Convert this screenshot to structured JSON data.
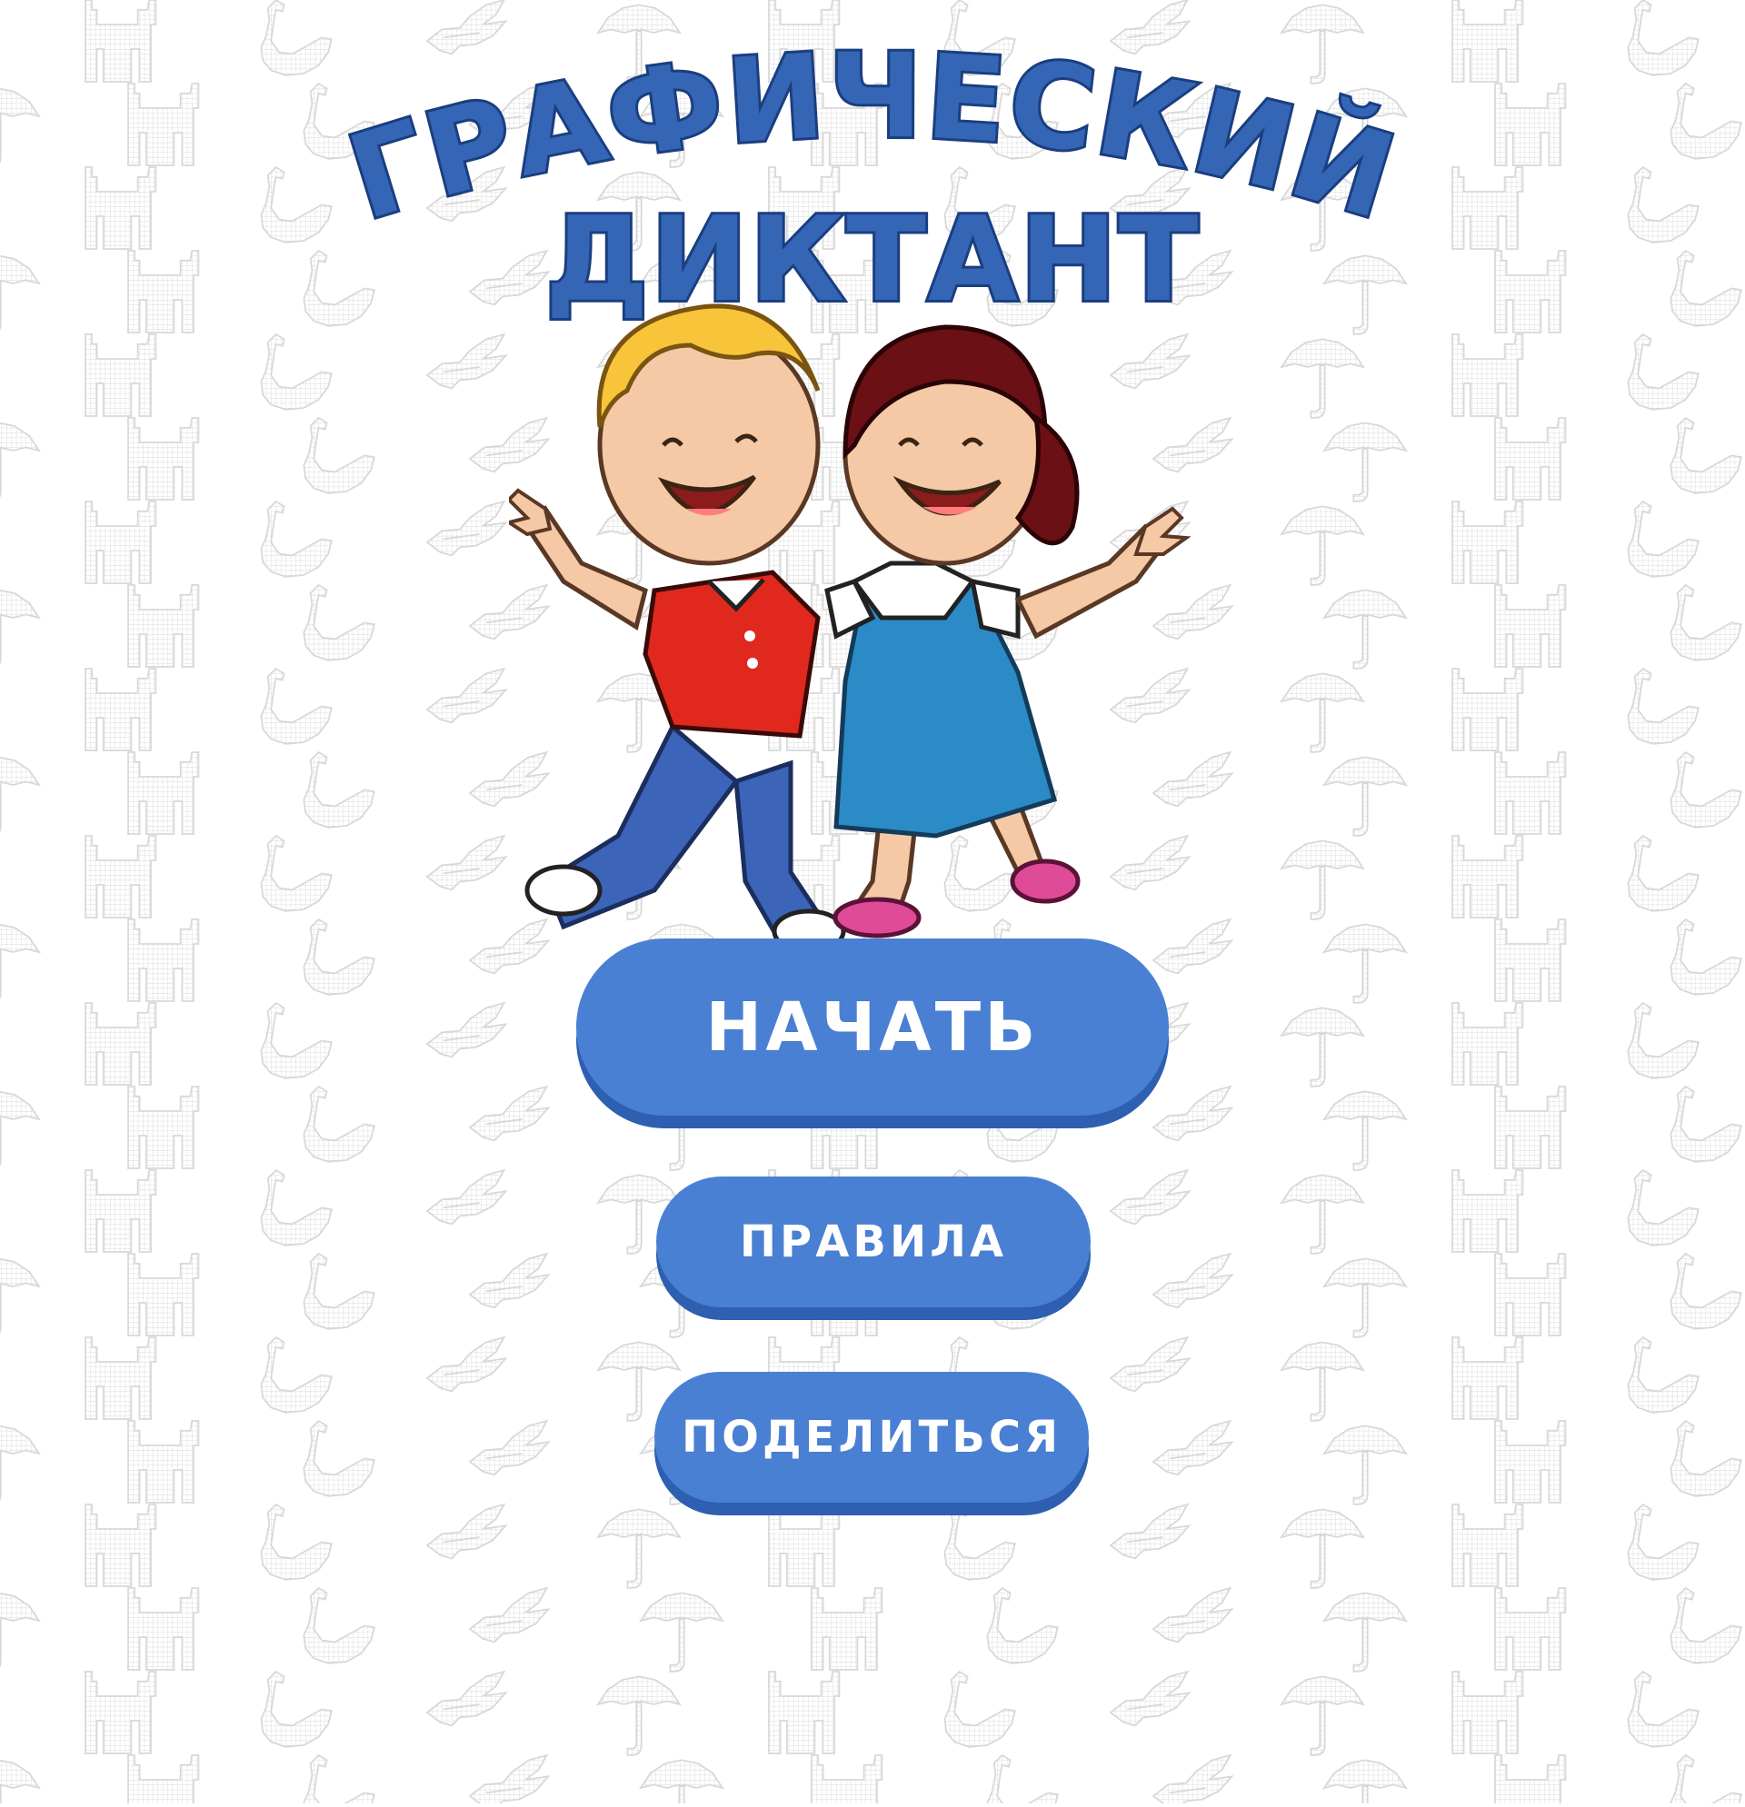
{
  "title": {
    "line1": "ГРАФИЧЕСКИЙ",
    "line2": "ДИКТАНТ"
  },
  "hero": {
    "icon": "cartoon-kids-illustration"
  },
  "buttons": {
    "start": "НАЧАТЬ",
    "rules": "ПРАВИЛА",
    "share": "ПОДЕЛИТЬСЯ"
  },
  "colors": {
    "title_fill": "#3566b5",
    "button": "#4a80d4",
    "button_shadow": "#2e5fb0",
    "background": "#ffffff",
    "pattern": "#e3e3e3"
  },
  "background_pattern": {
    "icons": [
      "umbrella-icon",
      "cat-icon",
      "swan-icon",
      "bird-icon"
    ]
  }
}
